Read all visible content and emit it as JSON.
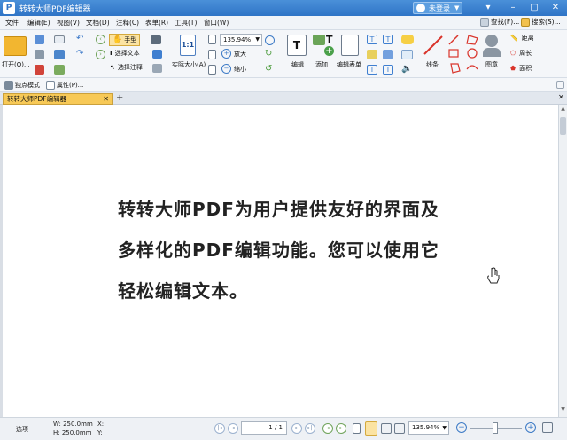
{
  "window": {
    "title": "转转大师PDF编辑器",
    "logo": "P"
  },
  "account": {
    "label": "未登录"
  },
  "menu": {
    "items": [
      "文件",
      "编辑(E)",
      "视图(V)",
      "文档(D)",
      "注释(C)",
      "表单(R)",
      "工具(T)",
      "窗口(W)"
    ],
    "find_label": "查找(F)...",
    "search_label": "搜索(S)..."
  },
  "ribbon": {
    "open_label": "打开(O)...",
    "hand_label": "手型",
    "select_text_label": "选择文本",
    "select_annot_label": "选择注释",
    "actual_size_label": "实际大小(A)",
    "zoom_value": "135.94%",
    "zoom_in_label": "放大",
    "zoom_out_label": "缩小",
    "edit_label": "编辑",
    "add_label": "添加",
    "edit_form_label": "编辑表单",
    "line_label": "线条",
    "stamp_label": "图章",
    "distance_label": "距离",
    "perimeter_label": "周长",
    "area_label": "面积"
  },
  "subtoolbar": {
    "snapshot_label": "独点模式",
    "properties_label": "属性(P)..."
  },
  "tabs": {
    "doc_tab": "转转大师PDF编辑器",
    "add": "+"
  },
  "document": {
    "lines": [
      "转转大师PDF为用户提供友好的界面及",
      "多样化的PDF编辑功能。您可以使用它",
      "轻松编辑文本。"
    ]
  },
  "status": {
    "options_label": "选项",
    "width_label": "W: 250.0mm",
    "height_label": "H: 250.0mm",
    "x_label": "X:",
    "y_label": "Y:",
    "page_value": "1 / 1",
    "zoom_value": "135.94%"
  },
  "colors": {
    "title_bar": "#2f74c6",
    "tab_active": "#f7c957",
    "accent_red": "#d9342b"
  }
}
